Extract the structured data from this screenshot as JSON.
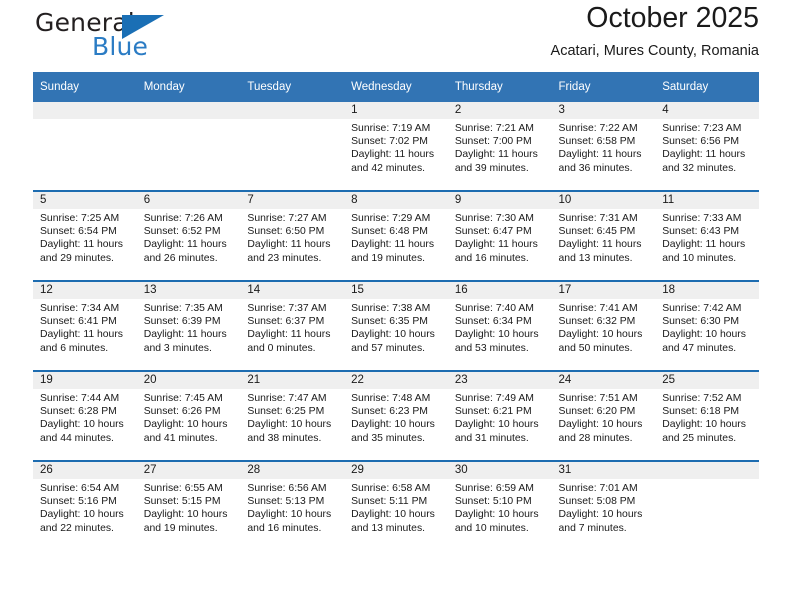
{
  "brand": {
    "word_general": "General",
    "word_blue": "Blue",
    "logo_icon": "triangle-flag-icon",
    "accent_color": "#2b7cc4"
  },
  "header": {
    "title": "October 2025",
    "subtitle": "Acatari, Mures County, Romania"
  },
  "theme": {
    "header_blue": "#3274b4",
    "rule_blue": "#1d6cb0",
    "daynum_gray": "#efefef"
  },
  "calendar": {
    "weekday_headers": [
      "Sunday",
      "Monday",
      "Tuesday",
      "Wednesday",
      "Thursday",
      "Friday",
      "Saturday"
    ],
    "labels": {
      "sunrise": "Sunrise:",
      "sunset": "Sunset:",
      "daylight": "Daylight:"
    },
    "weeks": [
      [
        {
          "day": "",
          "sunrise": "",
          "sunset": "",
          "daylight_line1": "",
          "daylight_line2": "",
          "blank": true
        },
        {
          "day": "",
          "sunrise": "",
          "sunset": "",
          "daylight_line1": "",
          "daylight_line2": "",
          "blank": true
        },
        {
          "day": "",
          "sunrise": "",
          "sunset": "",
          "daylight_line1": "",
          "daylight_line2": "",
          "blank": true
        },
        {
          "day": "1",
          "sunrise": "Sunrise: 7:19 AM",
          "sunset": "Sunset: 7:02 PM",
          "daylight_line1": "Daylight: 11 hours",
          "daylight_line2": "and 42 minutes."
        },
        {
          "day": "2",
          "sunrise": "Sunrise: 7:21 AM",
          "sunset": "Sunset: 7:00 PM",
          "daylight_line1": "Daylight: 11 hours",
          "daylight_line2": "and 39 minutes."
        },
        {
          "day": "3",
          "sunrise": "Sunrise: 7:22 AM",
          "sunset": "Sunset: 6:58 PM",
          "daylight_line1": "Daylight: 11 hours",
          "daylight_line2": "and 36 minutes."
        },
        {
          "day": "4",
          "sunrise": "Sunrise: 7:23 AM",
          "sunset": "Sunset: 6:56 PM",
          "daylight_line1": "Daylight: 11 hours",
          "daylight_line2": "and 32 minutes."
        }
      ],
      [
        {
          "day": "5",
          "sunrise": "Sunrise: 7:25 AM",
          "sunset": "Sunset: 6:54 PM",
          "daylight_line1": "Daylight: 11 hours",
          "daylight_line2": "and 29 minutes."
        },
        {
          "day": "6",
          "sunrise": "Sunrise: 7:26 AM",
          "sunset": "Sunset: 6:52 PM",
          "daylight_line1": "Daylight: 11 hours",
          "daylight_line2": "and 26 minutes."
        },
        {
          "day": "7",
          "sunrise": "Sunrise: 7:27 AM",
          "sunset": "Sunset: 6:50 PM",
          "daylight_line1": "Daylight: 11 hours",
          "daylight_line2": "and 23 minutes."
        },
        {
          "day": "8",
          "sunrise": "Sunrise: 7:29 AM",
          "sunset": "Sunset: 6:48 PM",
          "daylight_line1": "Daylight: 11 hours",
          "daylight_line2": "and 19 minutes."
        },
        {
          "day": "9",
          "sunrise": "Sunrise: 7:30 AM",
          "sunset": "Sunset: 6:47 PM",
          "daylight_line1": "Daylight: 11 hours",
          "daylight_line2": "and 16 minutes."
        },
        {
          "day": "10",
          "sunrise": "Sunrise: 7:31 AM",
          "sunset": "Sunset: 6:45 PM",
          "daylight_line1": "Daylight: 11 hours",
          "daylight_line2": "and 13 minutes."
        },
        {
          "day": "11",
          "sunrise": "Sunrise: 7:33 AM",
          "sunset": "Sunset: 6:43 PM",
          "daylight_line1": "Daylight: 11 hours",
          "daylight_line2": "and 10 minutes."
        }
      ],
      [
        {
          "day": "12",
          "sunrise": "Sunrise: 7:34 AM",
          "sunset": "Sunset: 6:41 PM",
          "daylight_line1": "Daylight: 11 hours",
          "daylight_line2": "and 6 minutes."
        },
        {
          "day": "13",
          "sunrise": "Sunrise: 7:35 AM",
          "sunset": "Sunset: 6:39 PM",
          "daylight_line1": "Daylight: 11 hours",
          "daylight_line2": "and 3 minutes."
        },
        {
          "day": "14",
          "sunrise": "Sunrise: 7:37 AM",
          "sunset": "Sunset: 6:37 PM",
          "daylight_line1": "Daylight: 11 hours",
          "daylight_line2": "and 0 minutes."
        },
        {
          "day": "15",
          "sunrise": "Sunrise: 7:38 AM",
          "sunset": "Sunset: 6:35 PM",
          "daylight_line1": "Daylight: 10 hours",
          "daylight_line2": "and 57 minutes."
        },
        {
          "day": "16",
          "sunrise": "Sunrise: 7:40 AM",
          "sunset": "Sunset: 6:34 PM",
          "daylight_line1": "Daylight: 10 hours",
          "daylight_line2": "and 53 minutes."
        },
        {
          "day": "17",
          "sunrise": "Sunrise: 7:41 AM",
          "sunset": "Sunset: 6:32 PM",
          "daylight_line1": "Daylight: 10 hours",
          "daylight_line2": "and 50 minutes."
        },
        {
          "day": "18",
          "sunrise": "Sunrise: 7:42 AM",
          "sunset": "Sunset: 6:30 PM",
          "daylight_line1": "Daylight: 10 hours",
          "daylight_line2": "and 47 minutes."
        }
      ],
      [
        {
          "day": "19",
          "sunrise": "Sunrise: 7:44 AM",
          "sunset": "Sunset: 6:28 PM",
          "daylight_line1": "Daylight: 10 hours",
          "daylight_line2": "and 44 minutes."
        },
        {
          "day": "20",
          "sunrise": "Sunrise: 7:45 AM",
          "sunset": "Sunset: 6:26 PM",
          "daylight_line1": "Daylight: 10 hours",
          "daylight_line2": "and 41 minutes."
        },
        {
          "day": "21",
          "sunrise": "Sunrise: 7:47 AM",
          "sunset": "Sunset: 6:25 PM",
          "daylight_line1": "Daylight: 10 hours",
          "daylight_line2": "and 38 minutes."
        },
        {
          "day": "22",
          "sunrise": "Sunrise: 7:48 AM",
          "sunset": "Sunset: 6:23 PM",
          "daylight_line1": "Daylight: 10 hours",
          "daylight_line2": "and 35 minutes."
        },
        {
          "day": "23",
          "sunrise": "Sunrise: 7:49 AM",
          "sunset": "Sunset: 6:21 PM",
          "daylight_line1": "Daylight: 10 hours",
          "daylight_line2": "and 31 minutes."
        },
        {
          "day": "24",
          "sunrise": "Sunrise: 7:51 AM",
          "sunset": "Sunset: 6:20 PM",
          "daylight_line1": "Daylight: 10 hours",
          "daylight_line2": "and 28 minutes."
        },
        {
          "day": "25",
          "sunrise": "Sunrise: 7:52 AM",
          "sunset": "Sunset: 6:18 PM",
          "daylight_line1": "Daylight: 10 hours",
          "daylight_line2": "and 25 minutes."
        }
      ],
      [
        {
          "day": "26",
          "sunrise": "Sunrise: 6:54 AM",
          "sunset": "Sunset: 5:16 PM",
          "daylight_line1": "Daylight: 10 hours",
          "daylight_line2": "and 22 minutes."
        },
        {
          "day": "27",
          "sunrise": "Sunrise: 6:55 AM",
          "sunset": "Sunset: 5:15 PM",
          "daylight_line1": "Daylight: 10 hours",
          "daylight_line2": "and 19 minutes."
        },
        {
          "day": "28",
          "sunrise": "Sunrise: 6:56 AM",
          "sunset": "Sunset: 5:13 PM",
          "daylight_line1": "Daylight: 10 hours",
          "daylight_line2": "and 16 minutes."
        },
        {
          "day": "29",
          "sunrise": "Sunrise: 6:58 AM",
          "sunset": "Sunset: 5:11 PM",
          "daylight_line1": "Daylight: 10 hours",
          "daylight_line2": "and 13 minutes."
        },
        {
          "day": "30",
          "sunrise": "Sunrise: 6:59 AM",
          "sunset": "Sunset: 5:10 PM",
          "daylight_line1": "Daylight: 10 hours",
          "daylight_line2": "and 10 minutes."
        },
        {
          "day": "31",
          "sunrise": "Sunrise: 7:01 AM",
          "sunset": "Sunset: 5:08 PM",
          "daylight_line1": "Daylight: 10 hours",
          "daylight_line2": "and 7 minutes."
        },
        {
          "day": "",
          "sunrise": "",
          "sunset": "",
          "daylight_line1": "",
          "daylight_line2": "",
          "blank": true
        }
      ]
    ]
  }
}
